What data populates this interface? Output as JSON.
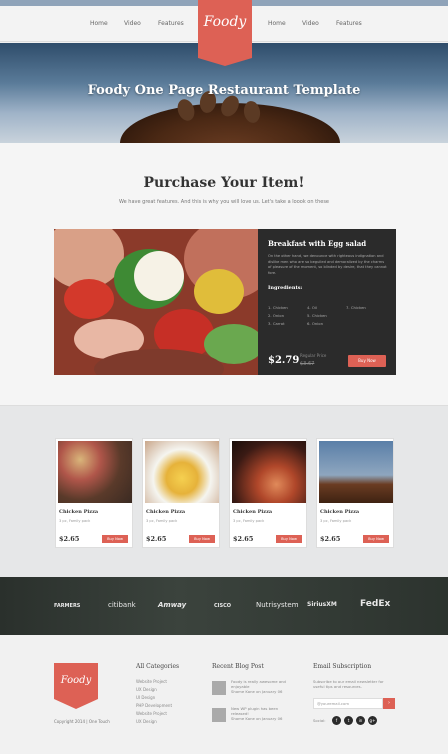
{
  "nav": {
    "left": [
      "Home",
      "Video",
      "Features"
    ],
    "right": [
      "Home",
      "Video",
      "Features"
    ],
    "logo": "Foody"
  },
  "hero": {
    "title": "Foody One Page Restaurant Template"
  },
  "purchase": {
    "title": "Purchase Your Item!",
    "subtitle": "We have great features. And this is why you will love us. Let's take a loook on these",
    "item": {
      "title": "Breakfast with Egg salad",
      "description": "On the other hand, we denounce with righteous indignation and dislike men who are so beguiled and demoralized by the charms of pleasure of the moment, so blinded by desire, that they cannot fore.",
      "ingredients_label": "Ingredients:",
      "ingredients": [
        "1. Chicken",
        "2. Onion",
        "3. Carrot",
        "4. Oil",
        "5. Chicken",
        "6. Onion",
        "7. Chicken"
      ],
      "price": "$2.79",
      "regular_label": "Regular Price",
      "regular_price": "$3.67",
      "buy": "Buy Now"
    }
  },
  "products": [
    {
      "name": "Chicken Pizza",
      "desc": "3 pc, Family pack",
      "price": "$2.65",
      "buy": "Buy Now"
    },
    {
      "name": "Chicken Pizza",
      "desc": "3 pc, Family pack",
      "price": "$2.65",
      "buy": "Buy Now"
    },
    {
      "name": "Chicken Pizza",
      "desc": "3 pc, Family pack",
      "price": "$2.65",
      "buy": "Buy Now"
    },
    {
      "name": "Chicken Pizza",
      "desc": "3 pc, Family pack",
      "price": "$2.65",
      "buy": "Buy Now"
    }
  ],
  "brands": [
    "FARMERS",
    "citibank",
    "Amway",
    "CISCO",
    "Nutrisystem",
    "SiriusXM",
    "FedEx"
  ],
  "footer": {
    "logo": "Foody",
    "copyright": "Copyright 2014 | One Touch",
    "categories_title": "All Categories",
    "categories": [
      "Website Project",
      "UX Design",
      "UI Design",
      "PHP Development",
      "Website Project",
      "UX Design"
    ],
    "blog_title": "Recent Blog Post",
    "blog": [
      {
        "text": "Foody is really awesome and enjoyable",
        "meta": "Shome Kane on January 06"
      },
      {
        "text": "New WP plugin has been released!",
        "meta": "Shome Kane on January 06"
      }
    ],
    "subscribe_title": "Email Subscription",
    "subscribe_desc": "Subscribe to our email newsletter for useful tips and resources.",
    "email_placeholder": "@youremail.com",
    "subscribe_button": "›",
    "social_label": "Social:",
    "social": [
      "f",
      "t",
      "in",
      "g+"
    ]
  }
}
